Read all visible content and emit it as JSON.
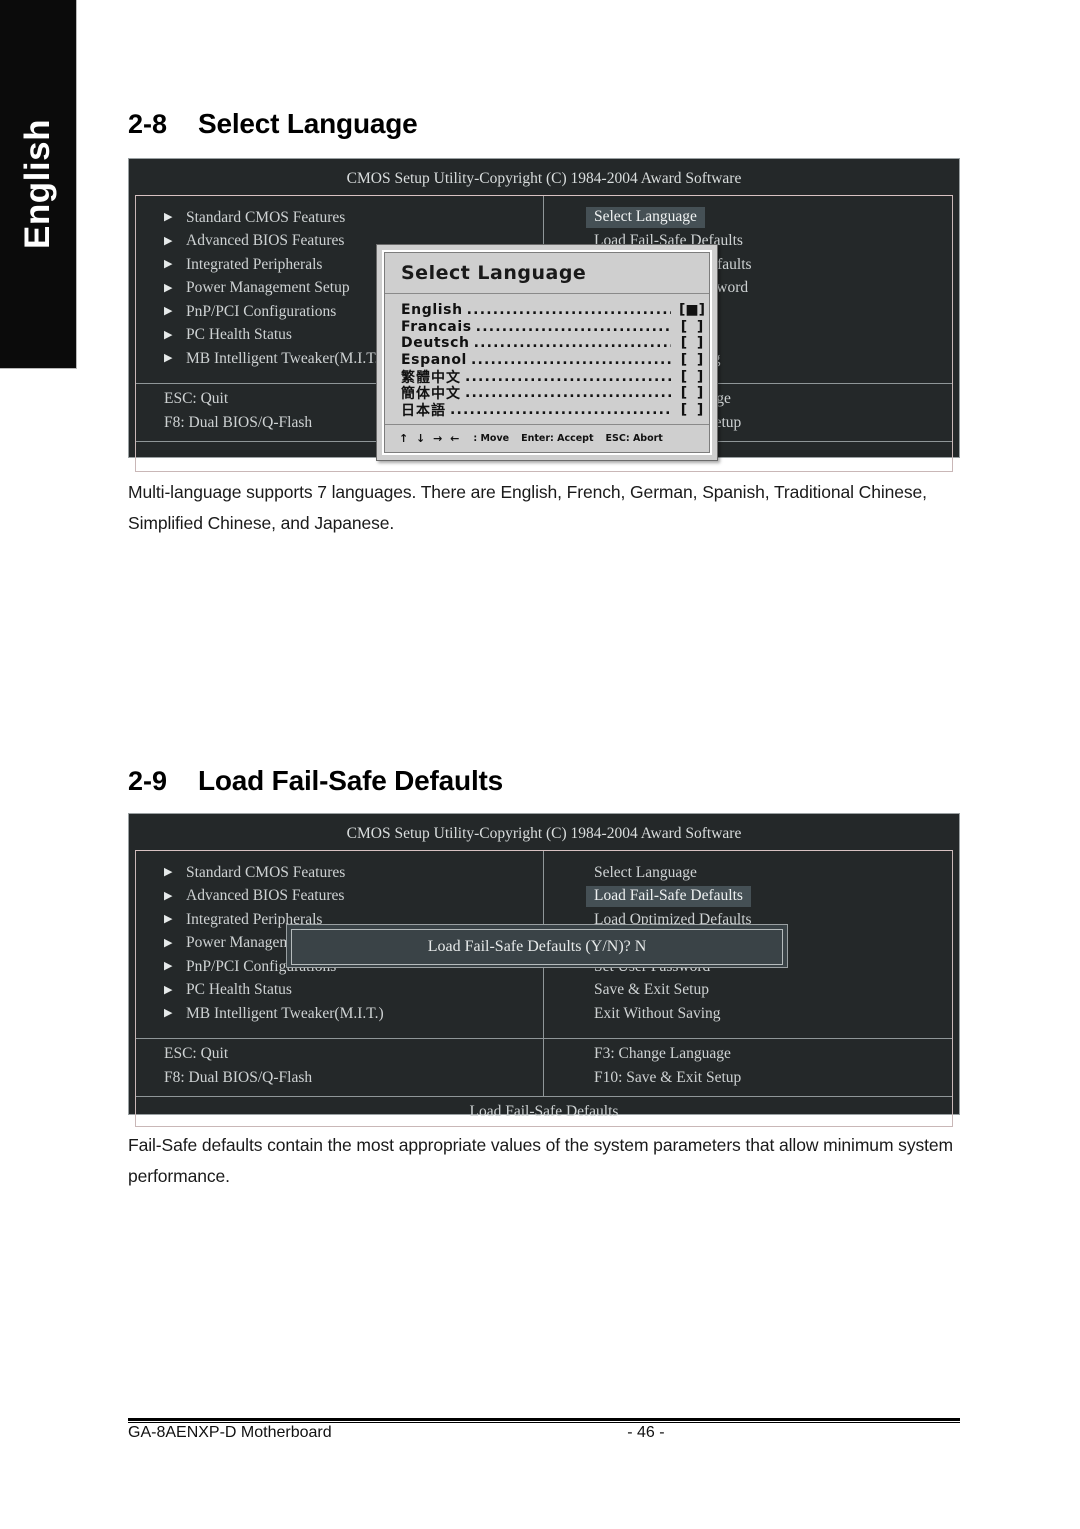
{
  "sidebar": {
    "label": "English"
  },
  "sections": [
    {
      "number": "2-8",
      "title": "Select Language",
      "caption": "Multi-language supports 7 languages. There are English, French, German, Spanish, Traditional Chinese, Simplified Chinese, and Japanese."
    },
    {
      "number": "2-9",
      "title": "Load Fail-Safe Defaults",
      "caption": "Fail-Safe defaults contain the most appropriate values of the system parameters that allow minimum system performance."
    }
  ],
  "bios": {
    "title": "CMOS Setup Utility-Copyright (C) 1984-2004 Award Software",
    "left_menu": [
      "Standard CMOS Features",
      "Advanced BIOS Features",
      "Integrated Peripherals",
      "Power Management Setup",
      "PnP/PCI Configurations",
      "PC Health Status",
      "MB Intelligent Tweaker(M.I.T.)"
    ],
    "right_menu": [
      "Select Language",
      "Load Fail-Safe Defaults",
      "Load Optimized Defaults",
      "Set Supervisor Password",
      "Set User Password",
      "Save & Exit Setup",
      "Exit Without Saving"
    ],
    "keys_left": [
      "ESC: Quit",
      "F8: Dual BIOS/Q-Flash"
    ],
    "keys_right": [
      "F3: Change Language",
      "F10: Save & Exit Setup"
    ],
    "status_screen1": "",
    "status_screen2": "Load Fail-Safe Defaults",
    "highlight_color": "#455055",
    "screen_bg": "#242829"
  },
  "language_dialog": {
    "heading": "Select Language",
    "dots": "........................................",
    "items": [
      {
        "name": "English",
        "selected": true,
        "mark": "■"
      },
      {
        "name": "Francais",
        "selected": false,
        "mark": ""
      },
      {
        "name": "Deutsch",
        "selected": false,
        "mark": ""
      },
      {
        "name": "Espanol",
        "selected": false,
        "mark": ""
      },
      {
        "name": "繁體中文",
        "selected": false,
        "mark": ""
      },
      {
        "name": "簡体中文",
        "selected": false,
        "mark": ""
      },
      {
        "name": "日本語",
        "selected": false,
        "mark": ""
      }
    ],
    "footer": {
      "arrows": "↑ ↓ → ←",
      "move_label": ": Move",
      "enter_label": "Enter: Accept",
      "esc_label": "ESC: Abort"
    }
  },
  "confirm_dialog": {
    "message": "Load Fail-Safe Defaults (Y/N)? N"
  },
  "footer": {
    "product": "GA-8AENXP-D Motherboard",
    "page": "- 46 -"
  }
}
